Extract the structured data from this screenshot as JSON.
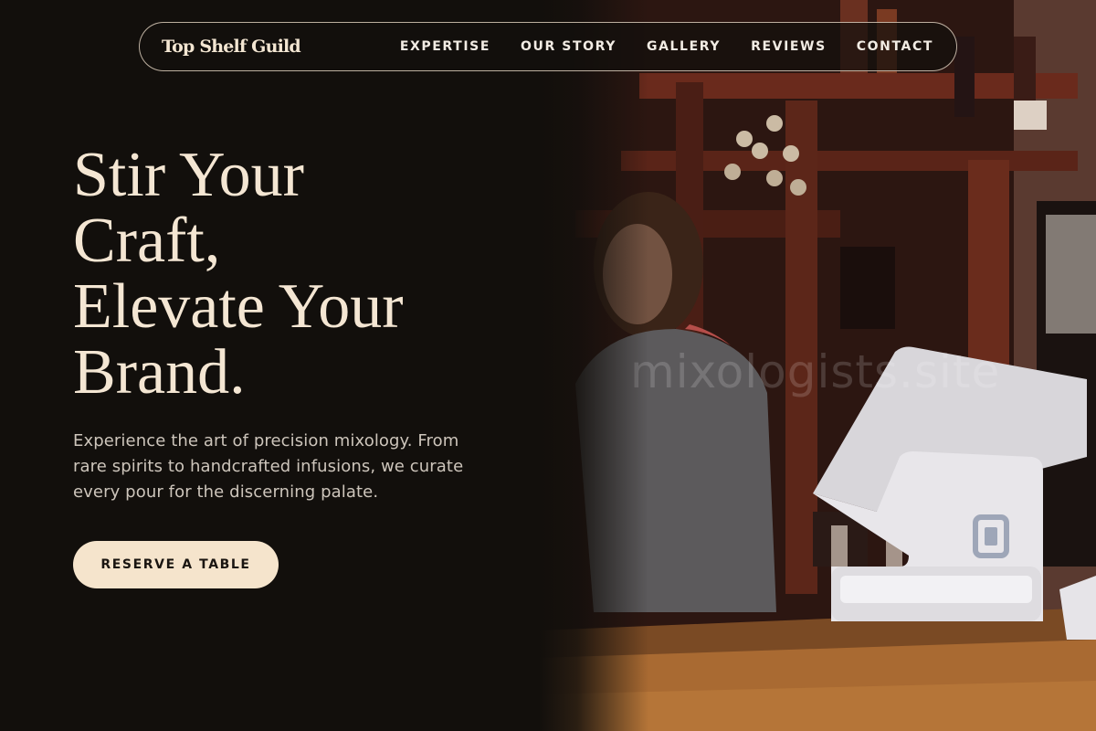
{
  "brand": {
    "name": "Top Shelf Guild"
  },
  "nav": {
    "links": [
      {
        "label": "EXPERTISE"
      },
      {
        "label": "OUR STORY"
      },
      {
        "label": "GALLERY"
      },
      {
        "label": "REVIEWS"
      },
      {
        "label": "CONTACT"
      }
    ]
  },
  "hero": {
    "title_lines": [
      "Stir Your",
      "Craft,",
      "Elevate Your",
      "Brand."
    ],
    "subtitle": "Experience the art of precision mixology. From rare spirits to handcrafted infusions, we curate every pour for the discerning palate.",
    "cta_label": "RESERVE A TABLE",
    "watermark": "mixologists.site",
    "image_subject": "bartender behind bar with wine shelves and a point-of-sale terminal on the counter"
  },
  "colors": {
    "background": "#120f0c",
    "accent": "#f5e4cc",
    "title_text": "#f4e6d3",
    "body_text": "#cdc5bb"
  }
}
